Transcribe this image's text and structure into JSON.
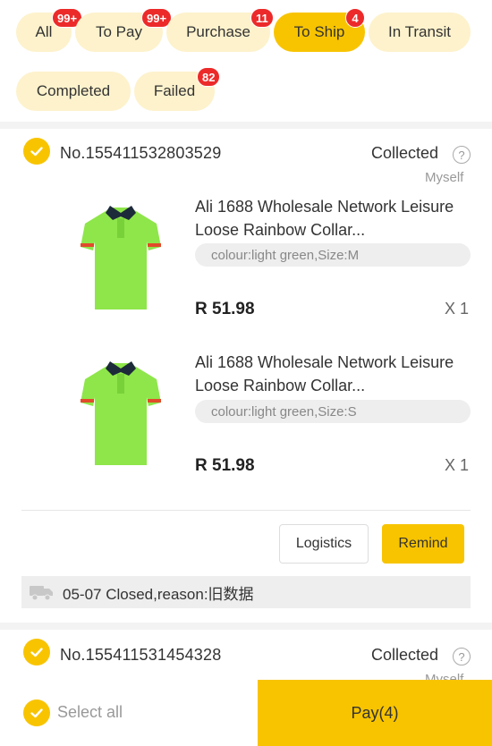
{
  "tabs": [
    {
      "label": "All",
      "badge": "99+"
    },
    {
      "label": "To Pay",
      "badge": "99+"
    },
    {
      "label": "Purchase",
      "badge": "11"
    },
    {
      "label": "To Ship",
      "badge": "4",
      "active": true
    },
    {
      "label": "In Transit",
      "badge": ""
    },
    {
      "label": "Completed",
      "badge": ""
    },
    {
      "label": "Failed",
      "badge": "82"
    }
  ],
  "orders": [
    {
      "number": "No.155411532803529",
      "status": "Collected",
      "help_glyph": "?",
      "sub": "Myself",
      "items": [
        {
          "name": "Ali 1688 Wholesale Network Leisure Loose Rainbow Collar...",
          "spec": "colour:light green,Size:M",
          "price": "R 51.98",
          "qty": "X 1",
          "image": "green-polo-shirt"
        },
        {
          "name": "Ali 1688 Wholesale Network Leisure Loose Rainbow Collar...",
          "spec": "colour:light green,Size:S",
          "price": "R 51.98",
          "qty": "X 1",
          "image": "green-polo-shirt"
        }
      ],
      "actions": {
        "logistics": "Logistics",
        "remind": "Remind"
      },
      "closed_note": "05-07 Closed,reason:旧数据"
    },
    {
      "number": "No.155411531454328",
      "status": "Collected",
      "help_glyph": "?",
      "sub": "Myself"
    }
  ],
  "bottom": {
    "select_all": "Select all",
    "pay": "Pay(4)"
  },
  "colors": {
    "accent": "#f8c400",
    "tab_bg": "#fdf2cc",
    "badge": "#ec2a2a"
  },
  "icons": {
    "check": "check-circle-icon",
    "help": "question-circle-icon",
    "truck": "truck-icon"
  }
}
